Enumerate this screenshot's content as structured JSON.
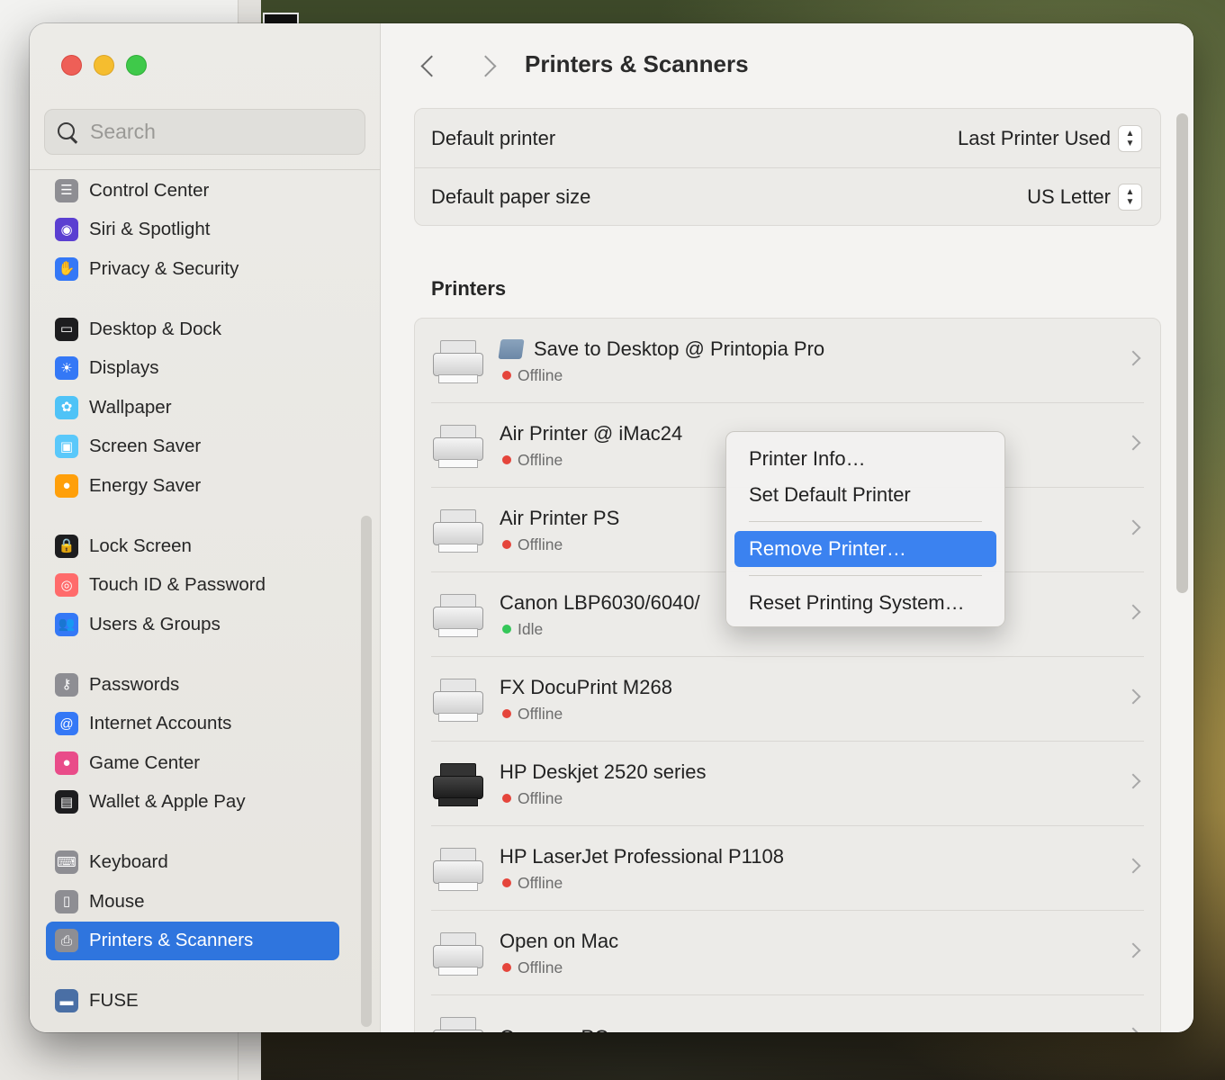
{
  "window": {
    "title": "Printers & Scanners"
  },
  "search": {
    "placeholder": "Search"
  },
  "sidebar": {
    "groups": [
      [
        {
          "label": "Control Center",
          "icon": "control-center-icon",
          "color": "#8e8e93"
        },
        {
          "label": "Siri & Spotlight",
          "icon": "siri-icon",
          "color": "#5b3fd1"
        },
        {
          "label": "Privacy & Security",
          "icon": "hand-icon",
          "color": "#3478f6"
        }
      ],
      [
        {
          "label": "Desktop & Dock",
          "icon": "dock-icon",
          "color": "#1d1d1f"
        },
        {
          "label": "Displays",
          "icon": "sun-icon",
          "color": "#3478f6"
        },
        {
          "label": "Wallpaper",
          "icon": "flower-icon",
          "color": "#4fc3f7"
        },
        {
          "label": "Screen Saver",
          "icon": "screen-saver-icon",
          "color": "#5ac8fa"
        },
        {
          "label": "Energy Saver",
          "icon": "lightbulb-icon",
          "color": "#ff9f0a"
        }
      ],
      [
        {
          "label": "Lock Screen",
          "icon": "lock-icon",
          "color": "#1d1d1f"
        },
        {
          "label": "Touch ID & Password",
          "icon": "fingerprint-icon",
          "color": "#ff6b6b"
        },
        {
          "label": "Users & Groups",
          "icon": "users-icon",
          "color": "#3478f6"
        }
      ],
      [
        {
          "label": "Passwords",
          "icon": "key-icon",
          "color": "#8e8e93"
        },
        {
          "label": "Internet Accounts",
          "icon": "at-icon",
          "color": "#3478f6"
        },
        {
          "label": "Game Center",
          "icon": "game-center-icon",
          "color": "#e94c89"
        },
        {
          "label": "Wallet & Apple Pay",
          "icon": "wallet-icon",
          "color": "#1d1d1f"
        }
      ],
      [
        {
          "label": "Keyboard",
          "icon": "keyboard-icon",
          "color": "#8e8e93"
        },
        {
          "label": "Mouse",
          "icon": "mouse-icon",
          "color": "#8e8e93"
        },
        {
          "label": "Printers & Scanners",
          "icon": "printer-icon",
          "color": "#8e8e93",
          "active": true
        }
      ],
      [
        {
          "label": "FUSE",
          "icon": "fuse-icon",
          "color": "#4a6fa5"
        }
      ]
    ]
  },
  "defaults": {
    "printer_label": "Default printer",
    "printer_value": "Last Printer Used",
    "paper_label": "Default paper size",
    "paper_value": "US Letter"
  },
  "printers_section": {
    "title": "Printers",
    "items": [
      {
        "name": "Save to Desktop @ Printopia Pro",
        "status": "Offline",
        "status_color": "#e5453b",
        "folder": true,
        "icon": "printer-icon"
      },
      {
        "name": "Air Printer @ iMac24",
        "status": "Offline",
        "status_color": "#e5453b",
        "icon": "printer-icon"
      },
      {
        "name": "Air Printer PS",
        "status": "Offline",
        "status_color": "#e5453b",
        "icon": "printer-icon"
      },
      {
        "name": "Canon LBP6030/6040/",
        "status": "Idle",
        "status_color": "#34c759",
        "icon": "printer-icon"
      },
      {
        "name": "FX DocuPrint M268",
        "status": "Offline",
        "status_color": "#e5453b",
        "icon": "printer-icon"
      },
      {
        "name": "HP Deskjet 2520 series",
        "status": "Offline",
        "status_color": "#e5453b",
        "dark": true,
        "icon": "printer-icon"
      },
      {
        "name": "HP LaserJet Professional P1108",
        "status": "Offline",
        "status_color": "#e5453b",
        "icon": "printer-icon"
      },
      {
        "name": "Open on Mac",
        "status": "Offline",
        "status_color": "#e5453b",
        "icon": "printer-icon"
      },
      {
        "name": "Open on PC",
        "status": "",
        "status_color": "#e5453b",
        "icon": "printer-icon"
      }
    ]
  },
  "context_menu": {
    "printer_info": "Printer Info…",
    "set_default": "Set Default Printer",
    "remove": "Remove Printer…",
    "reset": "Reset Printing System…"
  }
}
